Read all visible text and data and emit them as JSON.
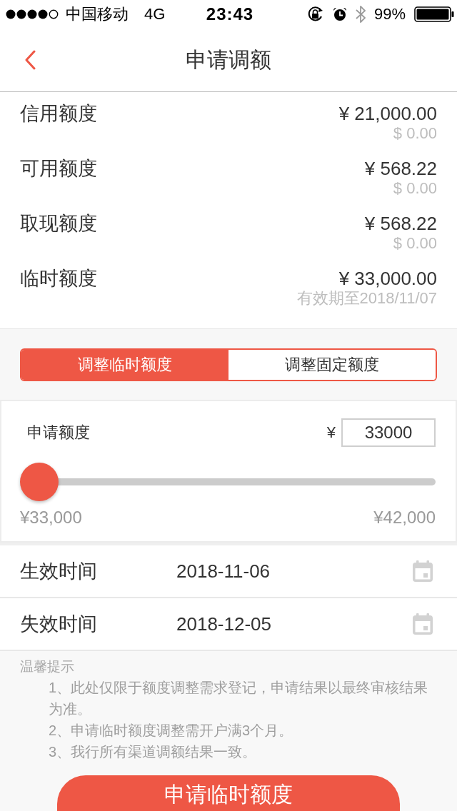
{
  "status_bar": {
    "carrier": "中国移动",
    "network": "4G",
    "time": "23:43",
    "battery": "99%"
  },
  "nav": {
    "title": "申请调额"
  },
  "limits": [
    {
      "label": "信用额度",
      "amount": "¥ 21,000.00",
      "sub": "$ 0.00"
    },
    {
      "label": "可用额度",
      "amount": "¥ 568.22",
      "sub": "$ 0.00"
    },
    {
      "label": "取现额度",
      "amount": "¥ 568.22",
      "sub": "$ 0.00"
    },
    {
      "label": "临时额度",
      "amount": "¥ 33,000.00",
      "sub": "有效期至2018/11/07"
    }
  ],
  "tabs": [
    {
      "label": "调整临时额度",
      "selected": true
    },
    {
      "label": "调整固定额度",
      "selected": false
    }
  ],
  "apply": {
    "label": "申请额度",
    "currency": "¥",
    "value": "33000",
    "slider": {
      "level": 0,
      "min_label": "¥33,000",
      "max_label": "¥42,000"
    }
  },
  "dates": [
    {
      "label": "生效时间",
      "value": "2018-11-06"
    },
    {
      "label": "失效时间",
      "value": "2018-12-05"
    }
  ],
  "tips": {
    "title": "温馨提示",
    "items": [
      "1、此处仅限于额度调整需求登记，申请结果以最终审核结果为准。",
      "2、申请临时额度调整需开户满3个月。",
      "3、我行所有渠道调额结果一致。"
    ]
  },
  "submit_button": "申请临时额度"
}
